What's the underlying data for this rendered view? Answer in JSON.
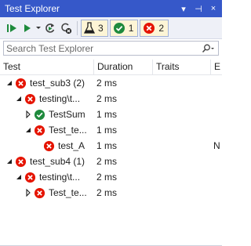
{
  "window": {
    "title": "Test Explorer",
    "menu_glyph": "▾",
    "pin_glyph": "⊣",
    "close_glyph": "×"
  },
  "toolbar": {
    "counts": {
      "total": "3",
      "passed": "1",
      "failed": "2"
    }
  },
  "search": {
    "placeholder": "Search Test Explorer",
    "value": ""
  },
  "columns": {
    "test": "Test",
    "duration": "Duration",
    "traits": "Traits",
    "extra": "E"
  },
  "rows": [
    {
      "label": "test_sub3  (2)",
      "duration": "2 ms",
      "traits": "",
      "extra": "",
      "status": "failed",
      "expander": "expanded",
      "depth": 0
    },
    {
      "label": "testing\\t...",
      "duration": "2 ms",
      "traits": "",
      "extra": "",
      "status": "failed",
      "expander": "expanded",
      "depth": 1
    },
    {
      "label": "TestSum",
      "duration": "1 ms",
      "traits": "",
      "extra": "",
      "status": "passed",
      "expander": "collapsed",
      "depth": 2
    },
    {
      "label": "Test_te...",
      "duration": "1 ms",
      "traits": "",
      "extra": "",
      "status": "failed",
      "expander": "expanded",
      "depth": 2
    },
    {
      "label": "test_A",
      "duration": "1 ms",
      "traits": "",
      "extra": "N",
      "status": "failed",
      "expander": "none",
      "depth": 3
    },
    {
      "label": "test_sub4  (1)",
      "duration": "2 ms",
      "traits": "",
      "extra": "",
      "status": "failed",
      "expander": "expanded",
      "depth": 0
    },
    {
      "label": "testing\\t...",
      "duration": "2 ms",
      "traits": "",
      "extra": "",
      "status": "failed",
      "expander": "expanded",
      "depth": 1
    },
    {
      "label": "Test_te...",
      "duration": "2 ms",
      "traits": "",
      "extra": "",
      "status": "failed",
      "expander": "collapsed",
      "depth": 2
    }
  ],
  "colors": {
    "titlebar": "#3658c9",
    "failed": "#e51400",
    "passed": "#1e8a3c",
    "run_green": "#1e8a3c",
    "toolbar_bg": "#eef0f7"
  }
}
